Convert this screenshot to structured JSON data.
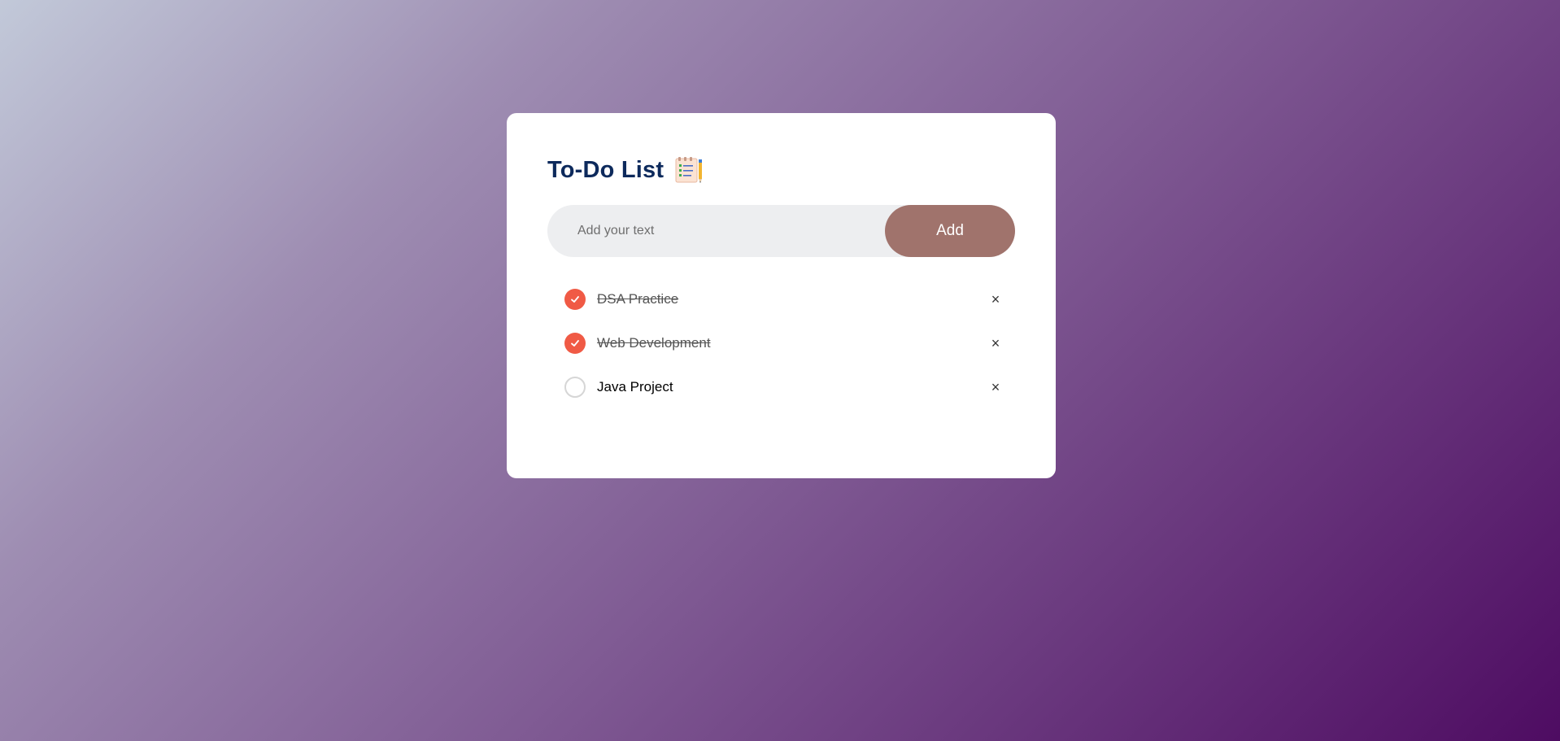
{
  "app": {
    "title": "To-Do List",
    "title_icon": "notepad-checklist-icon"
  },
  "input": {
    "placeholder": "Add your text",
    "value": "",
    "add_label": "Add"
  },
  "tasks": [
    {
      "text": "DSA Practice",
      "done": true
    },
    {
      "text": "Web Development",
      "done": true
    },
    {
      "text": "Java Project",
      "done": false
    }
  ],
  "icons": {
    "delete": "×"
  },
  "colors": {
    "title": "#0d2a5c",
    "add_button": "#a0736c",
    "check_done": "#f05a45",
    "input_bg": "#edeef0"
  }
}
